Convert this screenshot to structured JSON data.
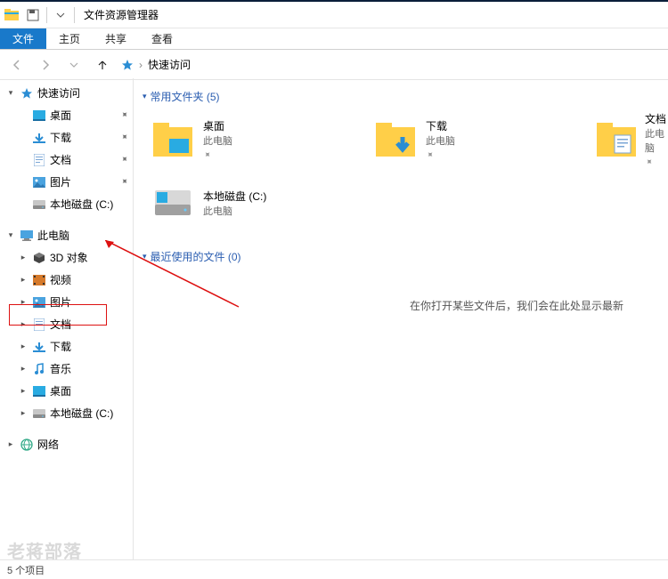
{
  "window": {
    "title": "文件资源管理器"
  },
  "ribbon": {
    "tabs": {
      "file": "文件",
      "home": "主页",
      "share": "共享",
      "view": "查看"
    }
  },
  "addressbar": {
    "location": "快速访问",
    "sep": "›"
  },
  "sidebar": {
    "quickAccess": "快速访问",
    "qa": {
      "desktop": "桌面",
      "downloads": "下载",
      "documents": "文档",
      "pictures": "图片",
      "localDiskC": "本地磁盘 (C:)"
    },
    "thisPC": "此电脑",
    "pc": {
      "objects3d": "3D 对象",
      "videos": "视频",
      "pictures": "图片",
      "documents": "文档",
      "downloads": "下载",
      "music": "音乐",
      "desktop": "桌面",
      "localDiskC": "本地磁盘 (C:)"
    },
    "network": "网络"
  },
  "content": {
    "frequentHeader": "常用文件夹 (5)",
    "recentHeader": "最近使用的文件 (0)",
    "emptyMessage": "在你打开某些文件后，我们会在此处显示最新",
    "tiles": {
      "desktop": {
        "name": "桌面",
        "sub": "此电脑"
      },
      "downloads": {
        "name": "下载",
        "sub": "此电脑"
      },
      "documents": {
        "name": "文档",
        "sub": "此电脑"
      },
      "localDiskC": {
        "name": "本地磁盘 (C:)",
        "sub": "此电脑"
      }
    }
  },
  "status": {
    "itemCount": "5 个项目"
  },
  "watermark": "老蒋部落"
}
